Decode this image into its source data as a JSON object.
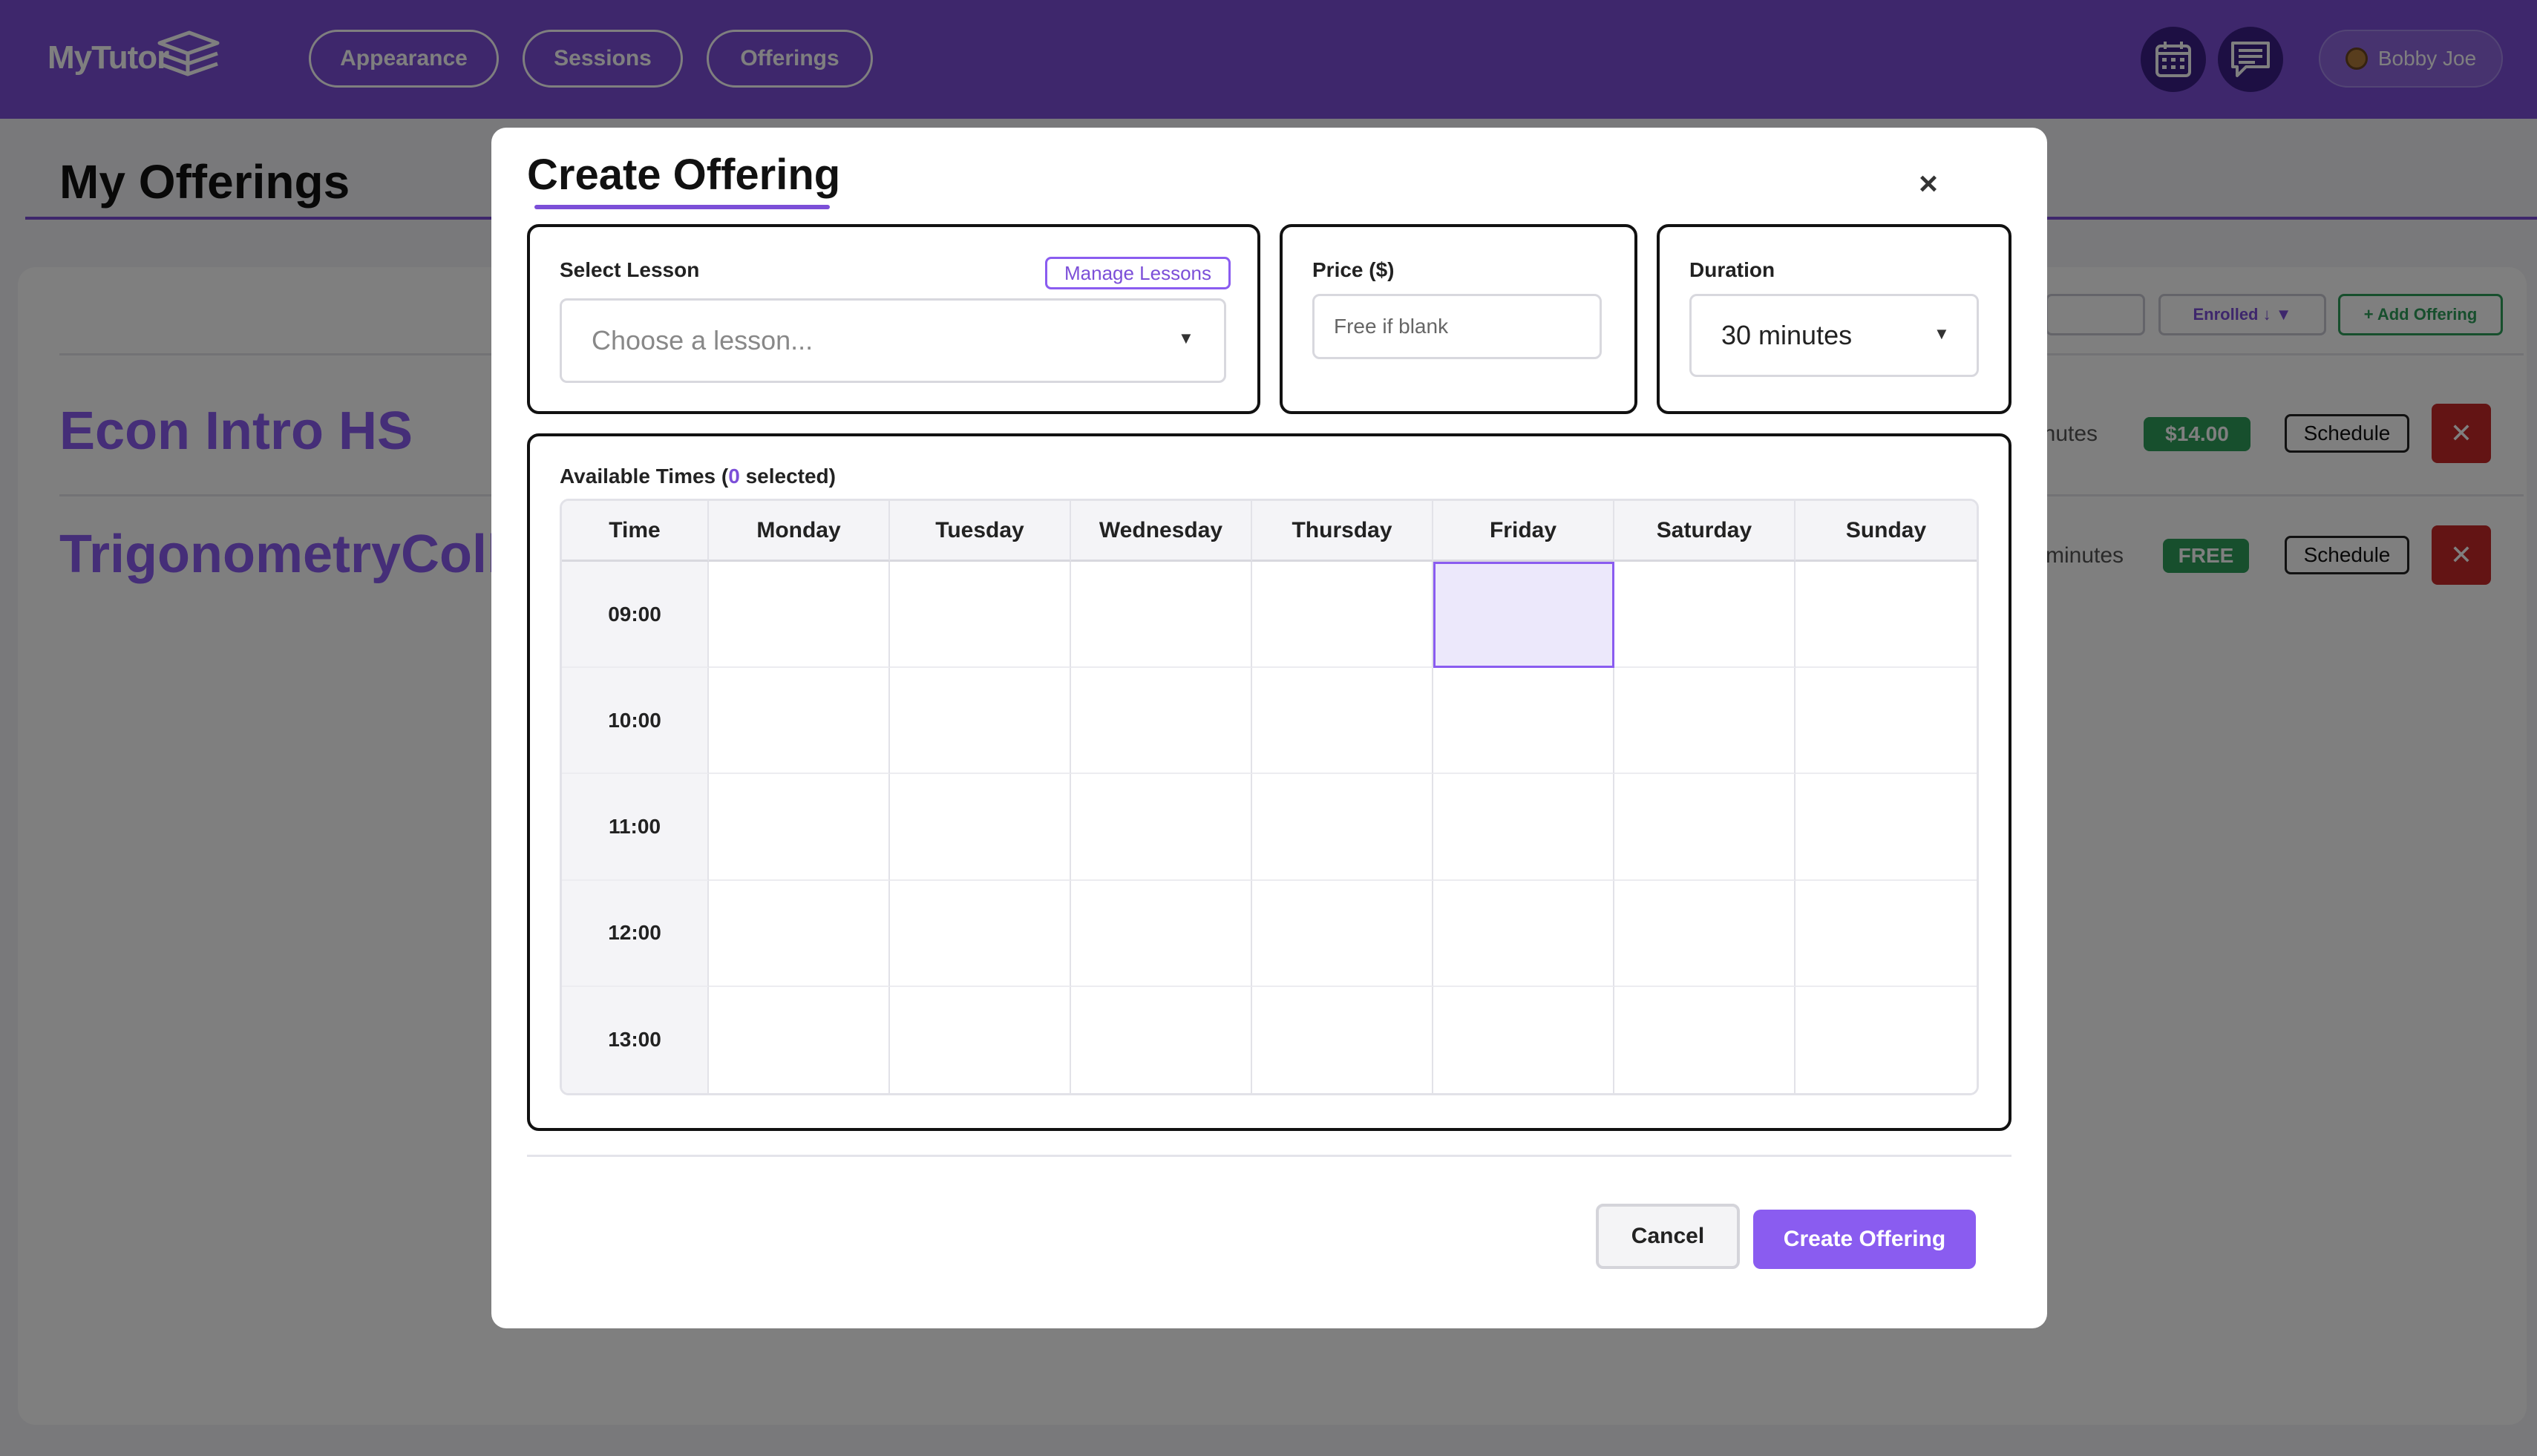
{
  "app": {
    "logo_text": "MyTutor",
    "nav": [
      {
        "label": "Appearance"
      },
      {
        "label": "Sessions"
      },
      {
        "label": "Offerings"
      }
    ],
    "user_name": "Bobby Joe"
  },
  "page": {
    "title": "My Offerings",
    "toolbar": {
      "sort_label": "Enrolled ↓ ▼",
      "add_label": "+ Add Offering"
    },
    "offerings": [
      {
        "name": "Econ Intro HS",
        "duration_text": "inutes",
        "price_badge": "$14.00",
        "schedule_label": "Schedule",
        "delete_label": "✕"
      },
      {
        "name": "TrigonometryColle",
        "duration_text": "minutes",
        "price_badge": "FREE",
        "schedule_label": "Schedule",
        "delete_label": "✕"
      }
    ]
  },
  "modal": {
    "title": "Create Offering",
    "close_label": "×",
    "lesson": {
      "label": "Select Lesson",
      "manage_label": "Manage Lessons",
      "placeholder": "Choose a lesson..."
    },
    "price": {
      "label": "Price ($)",
      "placeholder": "Free if blank",
      "value": ""
    },
    "duration": {
      "label": "Duration",
      "selected": "30 minutes"
    },
    "available_times": {
      "label_prefix": "Available Times (",
      "selected_count": "0",
      "label_suffix": " selected)",
      "header_time": "Time",
      "days": [
        "Monday",
        "Tuesday",
        "Wednesday",
        "Thursday",
        "Friday",
        "Saturday",
        "Sunday"
      ],
      "times": [
        "09:00",
        "10:00",
        "11:00",
        "12:00",
        "13:00"
      ]
    },
    "cancel_label": "Cancel",
    "create_label": "Create Offering"
  },
  "colors": {
    "brand": "#7c4fd8",
    "accent": "#8a5cf0",
    "success": "#2e9e5b",
    "danger": "#c62828"
  }
}
